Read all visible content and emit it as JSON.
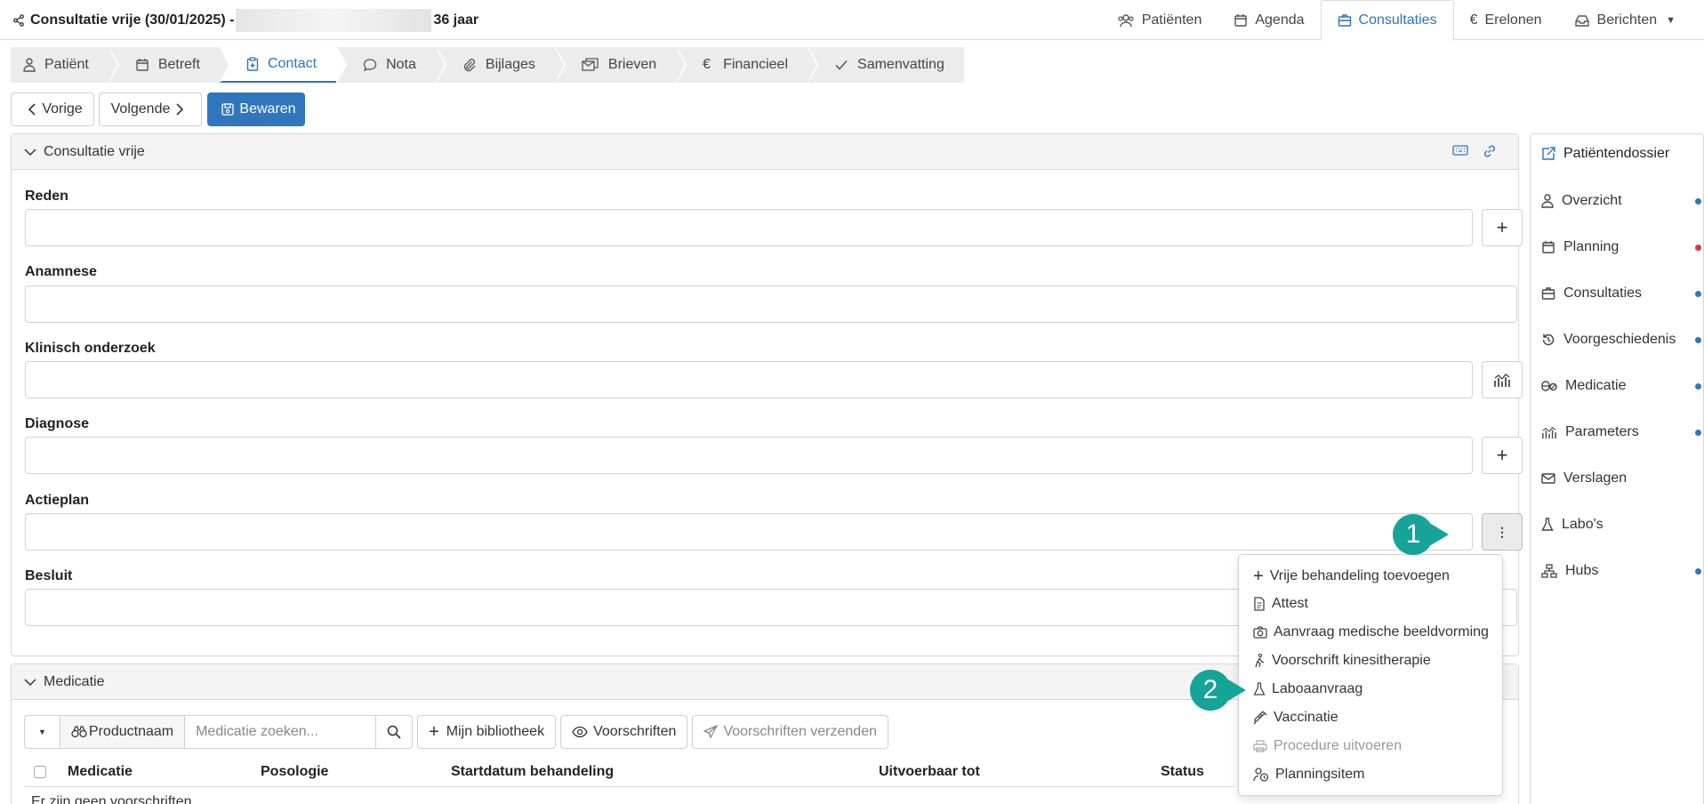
{
  "header": {
    "title_prefix": "Consultatie vrije (30/01/2025) -",
    "title_suffix": "36 jaar",
    "nav": [
      {
        "label": "Patiënten",
        "icon": "users-icon"
      },
      {
        "label": "Agenda",
        "icon": "calendar-icon"
      },
      {
        "label": "Consultaties",
        "icon": "briefcase-icon",
        "active": true
      },
      {
        "label": "Erelonen",
        "icon": "euro-icon"
      },
      {
        "label": "Berichten",
        "icon": "inbox-icon"
      }
    ]
  },
  "wizard": {
    "tabs": [
      {
        "label": "Patiënt",
        "icon": "person-icon"
      },
      {
        "label": "Betreft",
        "icon": "calendar-icon"
      },
      {
        "label": "Contact",
        "icon": "clipboard-icon",
        "active": true
      },
      {
        "label": "Nota",
        "icon": "chat-icon"
      },
      {
        "label": "Bijlages",
        "icon": "paperclip-icon"
      },
      {
        "label": "Brieven",
        "icon": "letters-icon"
      },
      {
        "label": "Financieel",
        "icon": "euro-icon"
      },
      {
        "label": "Samenvatting",
        "icon": "check-icon"
      }
    ]
  },
  "actions": {
    "prev": "Vorige",
    "next": "Volgende",
    "save": "Bewaren"
  },
  "consult_panel": {
    "title": "Consultatie vrije",
    "fields": {
      "reden": "Reden",
      "anamnese": "Anamnese",
      "klinisch": "Klinisch onderzoek",
      "diagnose": "Diagnose",
      "actieplan": "Actieplan",
      "besluit": "Besluit"
    }
  },
  "actieplan_menu": {
    "items": [
      {
        "label": "Vrije behandeling toevoegen",
        "icon": "plus-icon"
      },
      {
        "label": "Attest",
        "icon": "document-icon"
      },
      {
        "label": "Aanvraag medische beeldvorming",
        "icon": "camera-icon"
      },
      {
        "label": "Voorschrift kinesitherapie",
        "icon": "walking-person-icon"
      },
      {
        "label": "Laboaanvraag",
        "icon": "flask-icon"
      },
      {
        "label": "Vaccinatie",
        "icon": "syringe-icon"
      },
      {
        "label": "Procedure uitvoeren",
        "icon": "printer-icon",
        "disabled": true
      },
      {
        "label": "Planningsitem",
        "icon": "person-clock-icon"
      }
    ]
  },
  "callouts": [
    "1",
    "2"
  ],
  "medicatie_panel": {
    "title": "Medicatie",
    "search_mode": "Productnaam",
    "search_placeholder": "Medicatie zoeken...",
    "my_library": "Mijn bibliotheek",
    "prescriptions": "Voorschriften",
    "send_prescriptions": "Voorschriften verzenden",
    "columns": [
      "Medicatie",
      "Posologie",
      "Startdatum behandeling",
      "Uitvoerbaar tot",
      "Status"
    ],
    "empty": "Er zijn geen voorschriften"
  },
  "sidebar": {
    "items": [
      {
        "label": "Patiëntendossier",
        "icon": "external-edit-icon",
        "dot": null
      },
      {
        "label": "Overzicht",
        "icon": "person-icon",
        "dot": "blue"
      },
      {
        "label": "Planning",
        "icon": "calendar-icon",
        "dot": "red"
      },
      {
        "label": "Consultaties",
        "icon": "briefcase-icon",
        "dot": "blue"
      },
      {
        "label": "Voorgeschiedenis",
        "icon": "history-icon",
        "dot": "blue"
      },
      {
        "label": "Medicatie",
        "icon": "pills-icon",
        "dot": "blue"
      },
      {
        "label": "Parameters",
        "icon": "chart-icon",
        "dot": "blue"
      },
      {
        "label": "Verslagen",
        "icon": "envelope-icon",
        "dot": null
      },
      {
        "label": "Labo's",
        "icon": "flask-icon",
        "dot": null
      },
      {
        "label": "Hubs",
        "icon": "network-icon",
        "dot": "blue"
      }
    ]
  },
  "colors": {
    "accent": "#2a74c2",
    "primary_button": "#2f76bc",
    "callout": "#16a398",
    "dot_blue": "#2f76bc",
    "dot_red": "#e0344a"
  }
}
